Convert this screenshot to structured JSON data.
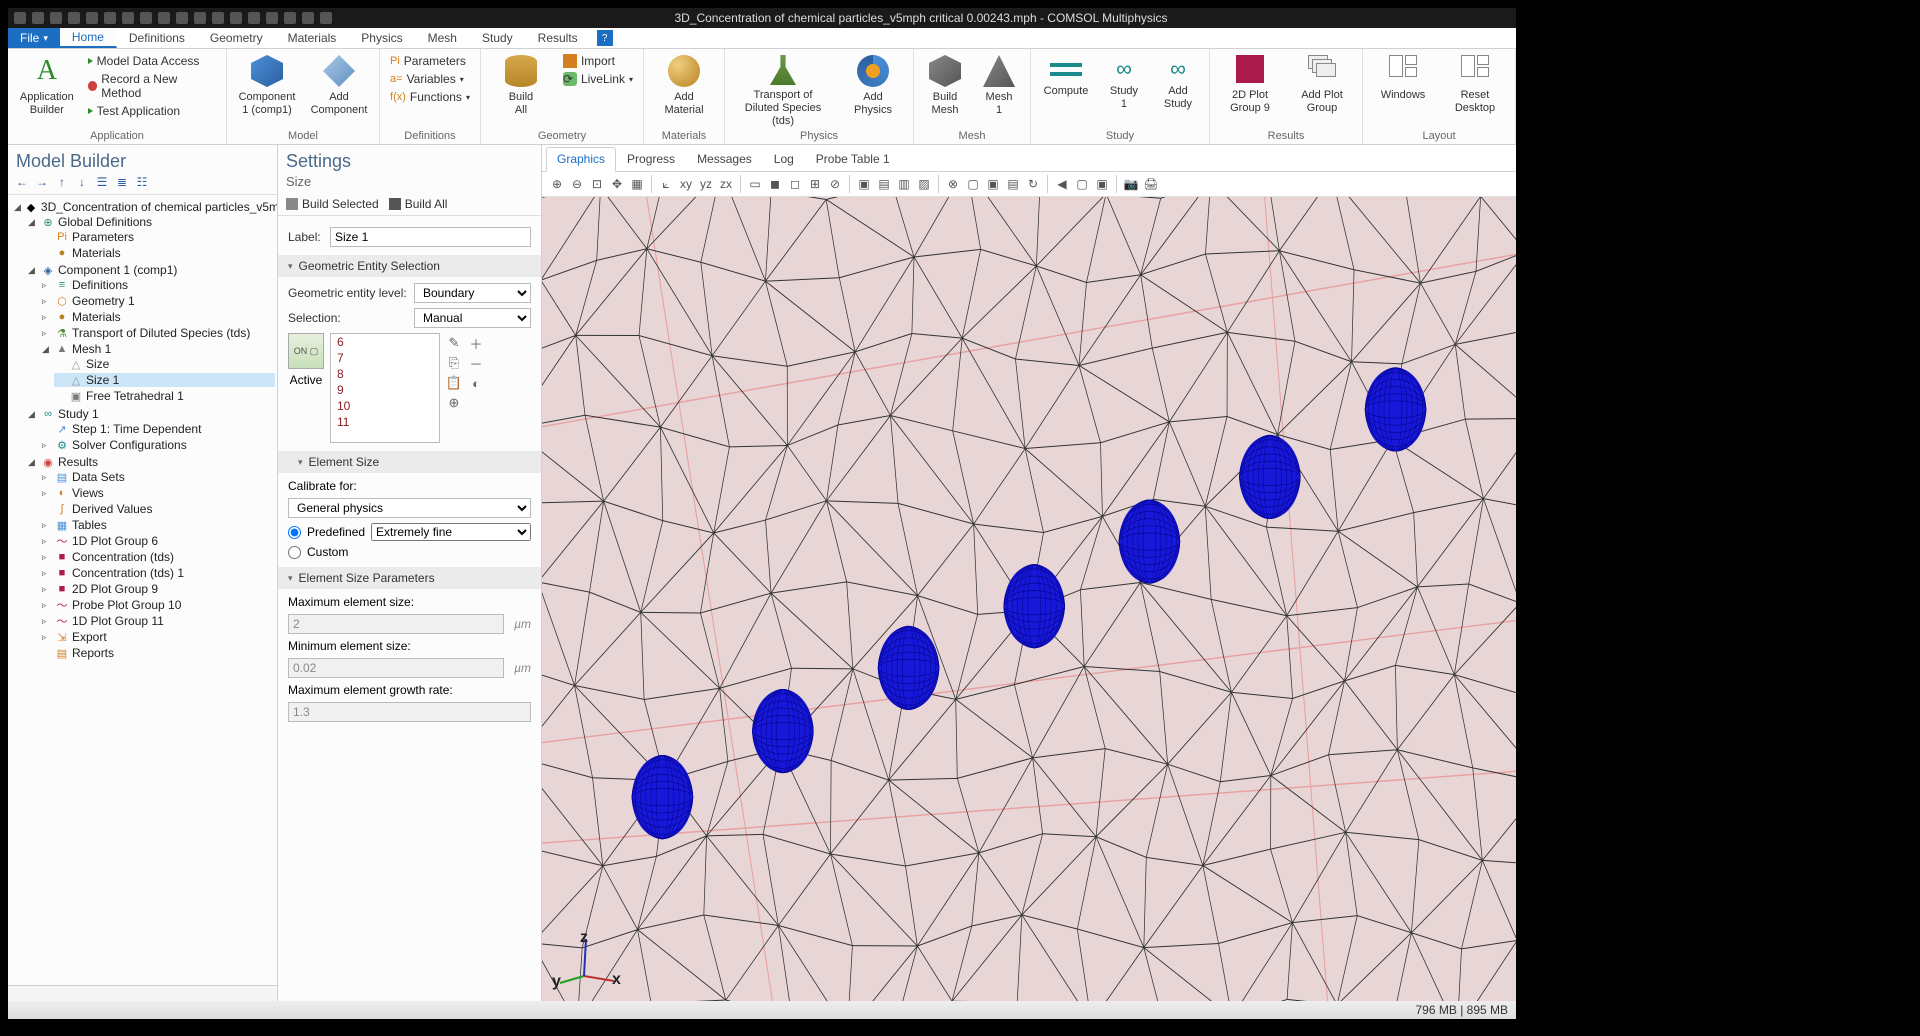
{
  "window": {
    "title": "3D_Concentration of chemical particles_v5mph critical 0.00243.mph - COMSOL Multiphysics"
  },
  "file_menu": {
    "label": "File"
  },
  "tabs": [
    "Home",
    "Definitions",
    "Geometry",
    "Materials",
    "Physics",
    "Mesh",
    "Study",
    "Results"
  ],
  "active_tab": 0,
  "ribbon": {
    "application": {
      "label": "Application",
      "builder": "Application\nBuilder",
      "items": [
        "Model Data Access",
        "Record a New Method",
        "Test Application"
      ]
    },
    "model": {
      "label": "Model",
      "component": "Component\n1 (comp1)",
      "add_component": "Add\nComponent"
    },
    "definitions": {
      "label": "Definitions",
      "items": [
        "Parameters",
        "Variables",
        "Functions"
      ]
    },
    "geometry": {
      "label": "Geometry",
      "build_all": "Build\nAll",
      "import": "Import",
      "livelink": "LiveLink"
    },
    "materials": {
      "label": "Materials",
      "add_material": "Add\nMaterial"
    },
    "physics": {
      "label": "Physics",
      "transport": "Transport of\nDiluted Species (tds)",
      "add_physics": "Add\nPhysics"
    },
    "mesh": {
      "label": "Mesh",
      "build_mesh": "Build\nMesh",
      "mesh1": "Mesh\n1"
    },
    "study": {
      "label": "Study",
      "compute": "Compute",
      "study1": "Study\n1",
      "add_study": "Add\nStudy"
    },
    "results": {
      "label": "Results",
      "plot2d": "2D Plot\nGroup 9",
      "add_plot": "Add Plot\nGroup"
    },
    "layout": {
      "label": "Layout",
      "windows": "Windows",
      "reset": "Reset\nDesktop"
    }
  },
  "model_builder": {
    "title": "Model Builder",
    "root": "3D_Concentration of chemical particles_v5m",
    "global": {
      "label": "Global Definitions",
      "children": [
        "Parameters",
        "Materials"
      ]
    },
    "component": {
      "label": "Component 1",
      "italic": "(comp1)",
      "children": [
        "Definitions",
        "Geometry 1",
        "Materials"
      ],
      "transport": {
        "label": "Transport of Diluted Species",
        "italic": "(tds)"
      },
      "mesh": {
        "label": "Mesh 1",
        "children": [
          "Size",
          "Size 1",
          "Free Tetrahedral 1"
        ],
        "selected": "Size 1"
      }
    },
    "study": {
      "label": "Study 1",
      "children": [
        "Step 1: Time Dependent",
        "Solver Configurations"
      ]
    },
    "results": {
      "label": "Results",
      "children": [
        "Data Sets",
        "Views",
        "Derived Values",
        "Tables",
        "1D Plot Group 6",
        "Concentration (tds)",
        "Concentration (tds) 1",
        "2D Plot Group 9",
        "Probe Plot Group 10",
        "1D Plot Group 11",
        "Export",
        "Reports"
      ]
    }
  },
  "settings": {
    "title": "Settings",
    "subtitle": "Size",
    "build_selected": "Build Selected",
    "build_all": "Build All",
    "label_label": "Label:",
    "label_value": "Size 1",
    "section_geom": "Geometric Entity Selection",
    "geom_level_label": "Geometric entity level:",
    "geom_level_value": "Boundary",
    "selection_label": "Selection:",
    "selection_value": "Manual",
    "active_label": "Active",
    "entities": [
      "6",
      "7",
      "8",
      "9",
      "10",
      "11"
    ],
    "section_size": "Element Size",
    "calibrate_label": "Calibrate for:",
    "calibrate_value": "General physics",
    "predefined_label": "Predefined",
    "predefined_value": "Extremely fine",
    "custom_label": "Custom",
    "section_params": "Element Size Parameters",
    "max_label": "Maximum element size:",
    "max_value": "2",
    "max_unit": "µm",
    "min_label": "Minimum element size:",
    "min_value": "0.02",
    "min_unit": "µm",
    "growth_label": "Maximum element growth rate:",
    "growth_value": "1.3"
  },
  "right": {
    "tabs": [
      "Graphics",
      "Progress",
      "Messages",
      "Log",
      "Probe Table 1"
    ],
    "active_tab": 0
  },
  "statusbar": {
    "memory": "796 MB | 895 MB"
  }
}
